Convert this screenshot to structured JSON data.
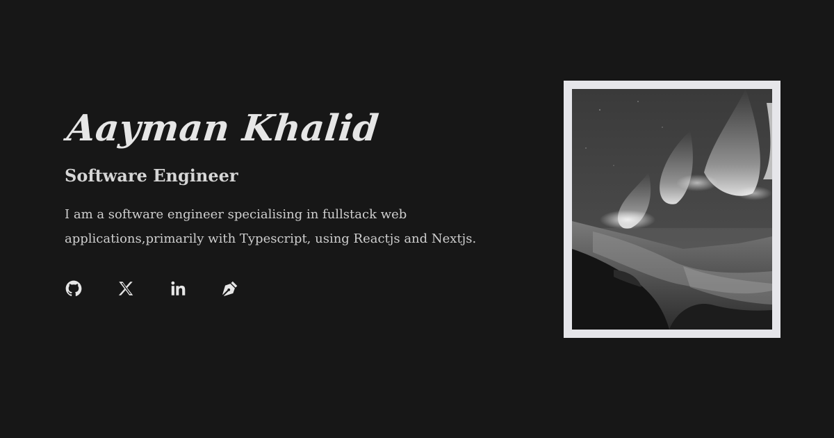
{
  "profile": {
    "name": "Aayman Khalid",
    "role": "Software Engineer",
    "bio": "I am a software engineer specialising in fullstack web applications,primarily with Typescript, using Reactjs and Nextjs."
  },
  "socials": [
    {
      "icon": "github-icon"
    },
    {
      "icon": "x-icon"
    },
    {
      "icon": "linkedin-icon"
    },
    {
      "icon": "pen-nib-icon"
    }
  ],
  "photo": {
    "subject": "aurora-over-mountains"
  }
}
